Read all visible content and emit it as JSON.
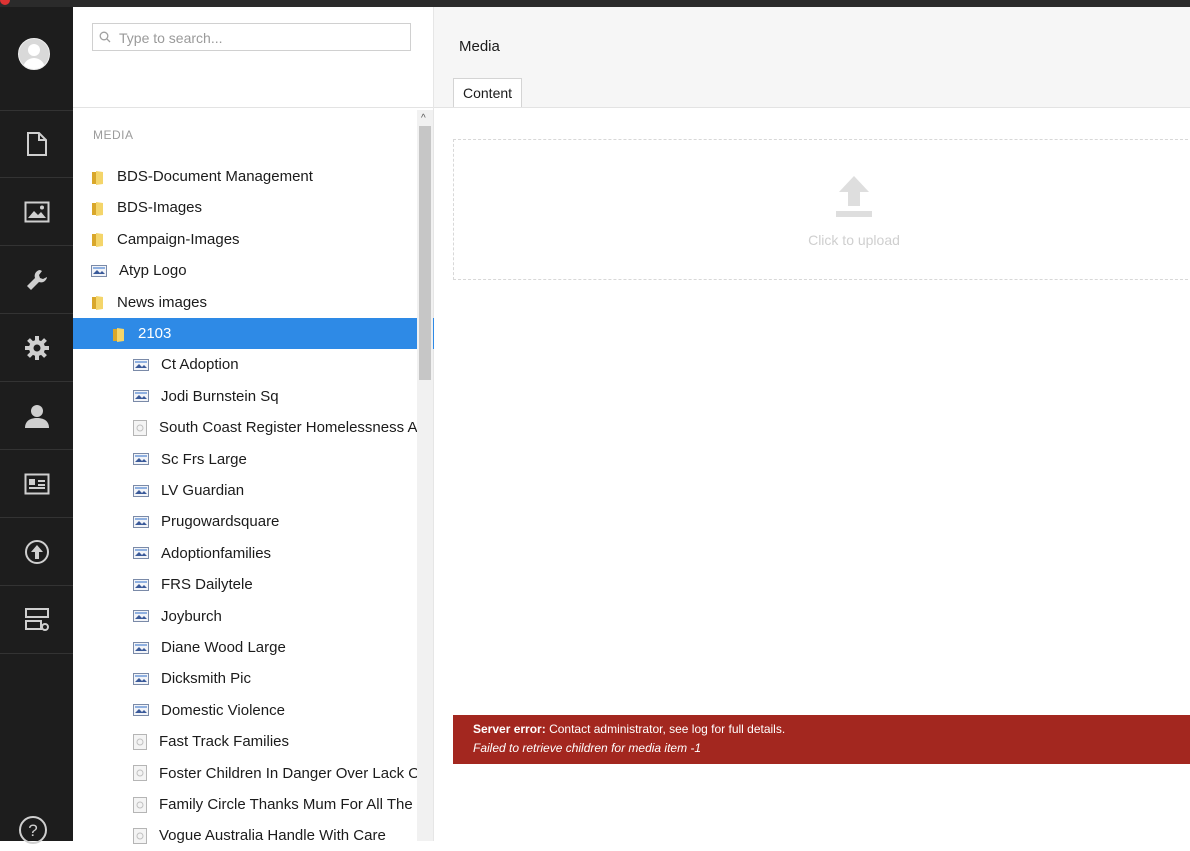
{
  "search": {
    "placeholder": "Type to search..."
  },
  "tree": {
    "section_title": "MEDIA",
    "items": [
      {
        "label": "BDS-Document Management",
        "type": "folder",
        "level": 0
      },
      {
        "label": "BDS-Images",
        "type": "folder",
        "level": 0
      },
      {
        "label": "Campaign-Images",
        "type": "folder",
        "level": 0
      },
      {
        "label": "Atyp Logo",
        "type": "image",
        "level": 0
      },
      {
        "label": "News images",
        "type": "folder",
        "level": 0
      },
      {
        "label": "2103",
        "type": "folder",
        "level": 1,
        "selected": true
      },
      {
        "label": "Ct Adoption",
        "type": "image",
        "level": 2
      },
      {
        "label": "Jodi Burnstein Sq",
        "type": "image",
        "level": 2
      },
      {
        "label": "South Coast Register Homelessness Av",
        "type": "file",
        "level": 2
      },
      {
        "label": "Sc Frs Large",
        "type": "image",
        "level": 2
      },
      {
        "label": "LV Guardian",
        "type": "image",
        "level": 2
      },
      {
        "label": "Prugowardsquare",
        "type": "image",
        "level": 2
      },
      {
        "label": "Adoptionfamilies",
        "type": "image",
        "level": 2
      },
      {
        "label": "FRS Dailytele",
        "type": "image",
        "level": 2
      },
      {
        "label": "Joyburch",
        "type": "image",
        "level": 2
      },
      {
        "label": "Diane Wood Large",
        "type": "image",
        "level": 2
      },
      {
        "label": "Dicksmith Pic",
        "type": "image",
        "level": 2
      },
      {
        "label": "Domestic Violence",
        "type": "image",
        "level": 2
      },
      {
        "label": "Fast Track Families",
        "type": "file",
        "level": 2
      },
      {
        "label": "Foster Children In Danger Over Lack Of",
        "type": "file",
        "level": 2
      },
      {
        "label": "Family Circle Thanks Mum For All The L",
        "type": "file",
        "level": 2
      },
      {
        "label": "Vogue Australia Handle With Care",
        "type": "file",
        "level": 2
      }
    ]
  },
  "main": {
    "title": "Media",
    "tab_label": "Content",
    "upload_text": "Click to upload"
  },
  "error": {
    "title": "Server error:",
    "message": "Contact administrator, see log for full details.",
    "detail": "Failed to retrieve children for media item -1"
  },
  "colors": {
    "rail_bg": "#1d1d1d",
    "selected_bg": "#2e8ae6",
    "error_bg": "#a3271f"
  },
  "icons": {
    "rail": [
      "content-icon",
      "media-icon",
      "settings-wrench-icon",
      "gear-icon",
      "user-icon",
      "member-card-icon",
      "deploy-icon",
      "forms-icon"
    ],
    "help": "help-icon"
  }
}
